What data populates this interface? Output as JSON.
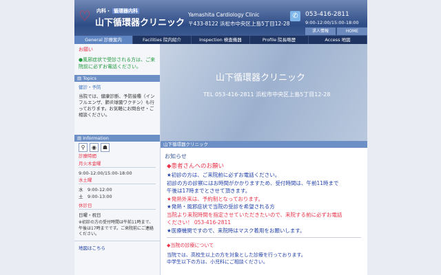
{
  "header": {
    "subtitle_a": "内科・",
    "subtitle_b": "循環器内科",
    "clinic_name": "山下循環器クリニック",
    "english_name": "Yamashita Cardiology Clinic",
    "address": "〒433-8122 浜松市中央区上島5丁目12-28",
    "tel": "053-416-2811",
    "hours": "9:00-12:00/15:00-18:00",
    "links": [
      "求人情報",
      "HOME"
    ]
  },
  "nav": [
    "General 診療案内",
    "Facilities 院内紹介",
    "Inspection 検査機器",
    "Profile 院長略歴",
    "Access 地図"
  ],
  "sidebar": {
    "notice_title": "お願い",
    "notice_text": "●風邪症状で受診される方は、ご来院前に必ずお電話ください。",
    "topics_title": "Topics",
    "topic_heading": "健診・予防",
    "topic_text": "当院では、健康診断、予防接種（インフルエンザ、肺炎球菌ワクチン）も行っております。お気軽にお問合せ・ご相談ください。",
    "info_title": "Information",
    "hours_title": "診療時間",
    "weekday_label": "月火木金曜",
    "weekday_hours": "9:00-12:00/15:00-18:00",
    "wedsat_label": "水土曜",
    "wed_hours": "水　9:00-12:00",
    "sat_hours": "土　9:00-13:00",
    "closed_label": "休診日",
    "closed_days": "日曜・祝日",
    "note": "※初診の方の受付時間は午前11時まで、午後は17時までです。ご来院前にご連絡ください。",
    "map_link": "地図はこちら"
  },
  "hero": {
    "title": "山下循環器クリニック",
    "tel_line": "TEL 053-416-2811 浜松市中央区上島5丁目12-28"
  },
  "main": {
    "bar_title": "山下循環器クリニック",
    "section": "お知らせ",
    "notice_heading": "◆患者さんへのお願い",
    "lines": [
      {
        "t": "★初診の方は、ご来院前に必ずお電話ください。",
        "c": "blue"
      },
      {
        "t": "初診の方の診察にはお時間がかかりますため、受付時間は、午前11時まで",
        "c": "blue"
      },
      {
        "t": "午後は17時までとさせて頂きます。",
        "c": "blue"
      },
      {
        "t": "★発熱外来は、予約制となっております。",
        "c": "red"
      },
      {
        "t": "★発熱・風邪症状で当院の受診を希望される方",
        "c": "blue"
      },
      {
        "t": "当院より来院時間を指定させていただきたいので、来院する前に必ずお電話",
        "c": "red"
      },
      {
        "t": "ください！ 053-416-2811",
        "c": "red"
      },
      {
        "t": "★医療機関ですので、来院時はマスク着用をお願いします。",
        "c": "blue"
      }
    ],
    "about_heading": "◆当院の診療について",
    "about_pre": "当院では、",
    "about_link": "高校生以上の方を対象とした診療",
    "about_post": "を行っております。",
    "about_line2": "中学生以下の方は、小児科にご相談ください。"
  }
}
